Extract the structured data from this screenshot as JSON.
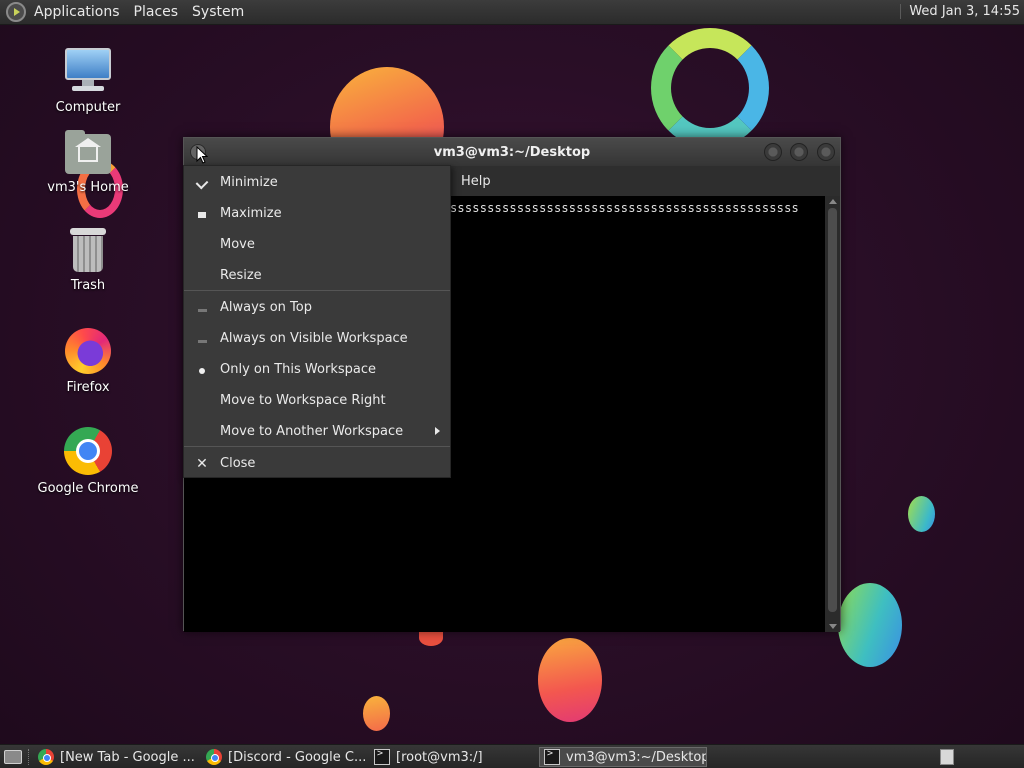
{
  "top_panel": {
    "menus": [
      "Applications",
      "Places",
      "System"
    ],
    "clock": "Wed Jan  3, 14:55"
  },
  "desktop_icons": [
    {
      "label": "Computer",
      "icon": "computer-icon"
    },
    {
      "label": "vm3's Home",
      "icon": "home-folder-icon"
    },
    {
      "label": "Trash",
      "icon": "trash-icon"
    },
    {
      "label": "Firefox",
      "icon": "firefox-icon"
    },
    {
      "label": "Google Chrome",
      "icon": "chrome-icon"
    }
  ],
  "window": {
    "title": "vm3@vm3:~/Desktop",
    "menu_help": "Help",
    "terminal_text": "sssssssssssssssssssssssssssssssssssssssssssssss"
  },
  "context_menu": {
    "items": [
      {
        "label": "Minimize",
        "icon": "minimize-icon"
      },
      {
        "label": "Maximize",
        "icon": "maximize-icon"
      },
      {
        "label": "Move",
        "icon": ""
      },
      {
        "label": "Resize",
        "icon": ""
      },
      {
        "label": "Always on Top",
        "icon": "checkbox-unchecked-icon"
      },
      {
        "label": "Always on Visible Workspace",
        "icon": "checkbox-unchecked-icon"
      },
      {
        "label": "Only on This Workspace",
        "icon": "radio-selected-icon"
      },
      {
        "label": "Move to Workspace Right",
        "icon": ""
      },
      {
        "label": "Move to Another Workspace",
        "icon": "submenu-arrow-icon"
      },
      {
        "label": "Close",
        "icon": "close-icon"
      }
    ]
  },
  "taskbar": {
    "tasks": [
      {
        "label": "[New Tab - Google ...",
        "icon": "chrome-icon",
        "active": false
      },
      {
        "label": "[Discord - Google C...",
        "icon": "chrome-icon",
        "active": false
      },
      {
        "label": "[root@vm3:/]",
        "icon": "terminal-icon",
        "active": false
      },
      {
        "label": "vm3@vm3:~/Desktop",
        "icon": "terminal-icon",
        "active": true
      }
    ]
  }
}
